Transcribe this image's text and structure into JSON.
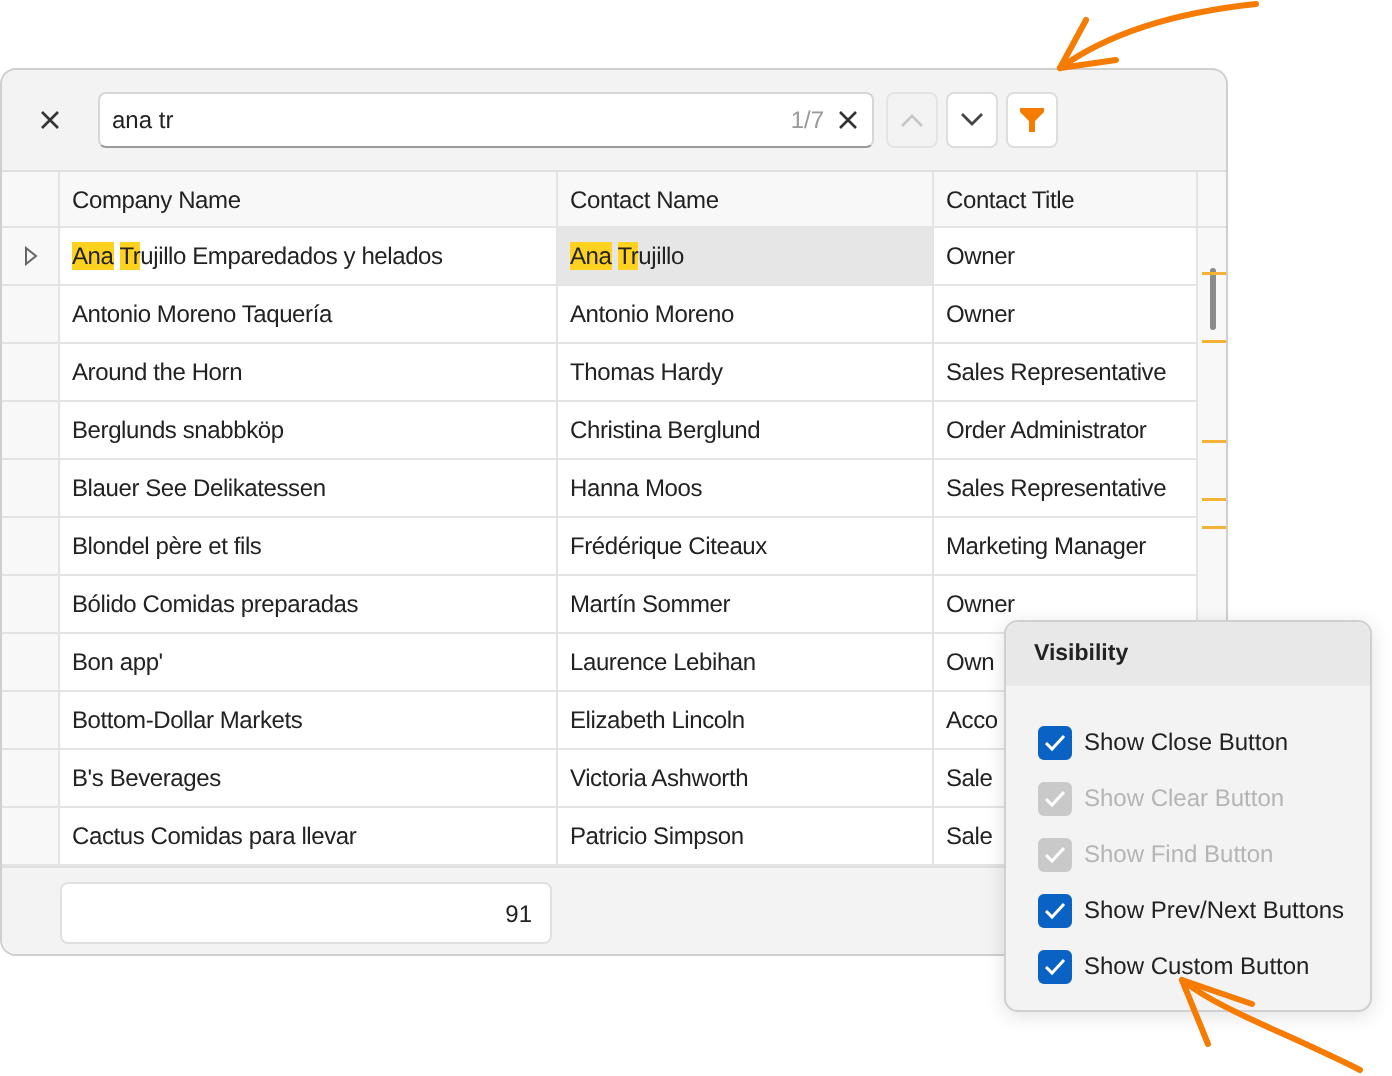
{
  "search": {
    "value": "ana tr",
    "counter": "1/7",
    "prev_disabled": true,
    "next_disabled": false
  },
  "table": {
    "columns": [
      "Company Name",
      "Contact Name",
      "Contact Title"
    ],
    "rows": [
      {
        "selected": true,
        "cells": [
          {
            "parts": [
              {
                "text": "Ana ",
                "match": true
              },
              {
                "text": "Tr",
                "match": true
              },
              {
                "text": "ujillo Emparedados y helados",
                "match": false
              }
            ]
          },
          {
            "focused": true,
            "parts": [
              {
                "text": "Ana ",
                "match": true
              },
              {
                "text": "Tr",
                "match": true
              },
              {
                "text": "ujillo",
                "match": false
              }
            ]
          },
          {
            "text": "Owner"
          }
        ]
      },
      {
        "selected": false,
        "cells": [
          {
            "text": "Antonio Moreno Taquería"
          },
          {
            "text": "Antonio Moreno"
          },
          {
            "text": "Owner"
          }
        ]
      },
      {
        "selected": false,
        "cells": [
          {
            "text": "Around the Horn"
          },
          {
            "text": "Thomas Hardy"
          },
          {
            "text": "Sales Representative"
          }
        ]
      },
      {
        "selected": false,
        "cells": [
          {
            "text": "Berglunds snabbköp"
          },
          {
            "text": "Christina Berglund"
          },
          {
            "text": "Order Administrator"
          }
        ]
      },
      {
        "selected": false,
        "cells": [
          {
            "text": "Blauer See Delikatessen"
          },
          {
            "text": "Hanna Moos"
          },
          {
            "text": "Sales Representative"
          }
        ]
      },
      {
        "selected": false,
        "cells": [
          {
            "text": "Blondel père et fils"
          },
          {
            "text": "Frédérique Citeaux"
          },
          {
            "text": "Marketing Manager"
          }
        ]
      },
      {
        "selected": false,
        "cells": [
          {
            "text": "Bólido Comidas preparadas"
          },
          {
            "text": "Martín Sommer"
          },
          {
            "text": "Owner"
          }
        ]
      },
      {
        "selected": false,
        "cells": [
          {
            "text": "Bon app'"
          },
          {
            "text": "Laurence Lebihan"
          },
          {
            "text": "Own"
          }
        ]
      },
      {
        "selected": false,
        "cells": [
          {
            "text": "Bottom-Dollar Markets"
          },
          {
            "text": "Elizabeth Lincoln"
          },
          {
            "text": "Acco"
          }
        ]
      },
      {
        "selected": false,
        "cells": [
          {
            "text": "B's Beverages"
          },
          {
            "text": "Victoria Ashworth"
          },
          {
            "text": "Sale"
          }
        ]
      },
      {
        "selected": false,
        "cells": [
          {
            "text": "Cactus Comidas para llevar"
          },
          {
            "text": "Patricio Simpson"
          },
          {
            "text": "Sale"
          }
        ]
      }
    ]
  },
  "summary": "91",
  "popup": {
    "title": "Visibility",
    "items": [
      {
        "label": "Show Close Button",
        "checked": true,
        "disabled": false
      },
      {
        "label": "Show Clear Button",
        "checked": true,
        "disabled": true
      },
      {
        "label": "Show Find Button",
        "checked": true,
        "disabled": true
      },
      {
        "label": "Show Prev/Next Buttons",
        "checked": true,
        "disabled": false
      },
      {
        "label": "Show Custom Button",
        "checked": true,
        "disabled": false
      }
    ]
  }
}
